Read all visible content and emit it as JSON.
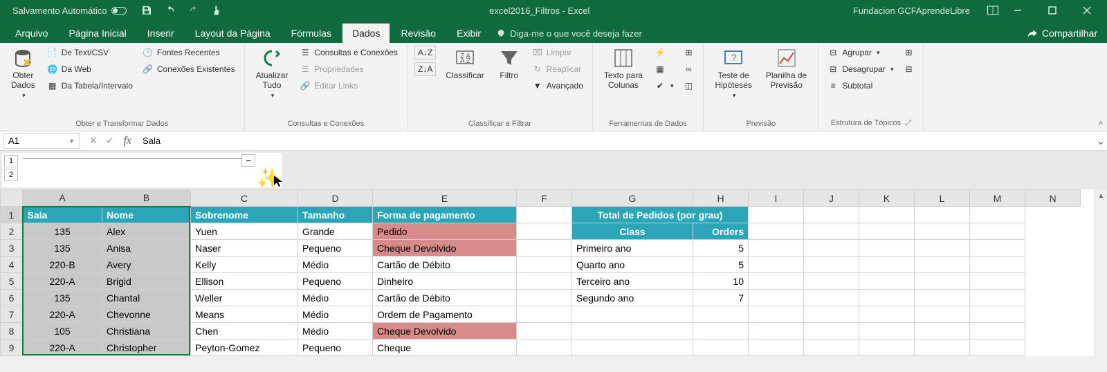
{
  "titlebar": {
    "autosave": "Salvamento Automático",
    "doc_title": "excel2016_Filtros - Excel",
    "account": "Fundacion GCFAprendeLibre"
  },
  "tabs": {
    "arquivo": "Arquivo",
    "inicial": "Página Inicial",
    "inserir": "Inserir",
    "layout": "Layout da Página",
    "formulas": "Fórmulas",
    "dados": "Dados",
    "revisao": "Revisão",
    "exibir": "Exibir",
    "tellme": "Diga-me o que você deseja fazer",
    "share": "Compartilhar"
  },
  "ribbon": {
    "obter_dados": "Obter\nDados",
    "de_text": "De Text/CSV",
    "da_web": "Da Web",
    "da_tabela": "Da Tabela/Intervalo",
    "fontes_recentes": "Fontes Recentes",
    "conexoes_existentes": "Conexões Existentes",
    "grp_obter": "Obter e Transformar Dados",
    "atualizar": "Atualizar\nTudo",
    "consultas": "Consultas e Conexões",
    "propriedades": "Propriedades",
    "editar_links": "Editar Links",
    "grp_consultas": "Consultas e Conexões",
    "az": "A↓Z",
    "za": "Z↓A",
    "classificar": "Classificar",
    "filtro": "Filtro",
    "limpar": "Limpar",
    "reaplicar": "Reaplicar",
    "avancado": "Avançado",
    "grp_classificar": "Classificar e Filtrar",
    "texto_colunas": "Texto para\nColunas",
    "grp_ferramentas": "Ferramentas de Dados",
    "teste": "Teste de\nHipóteses",
    "planilha": "Planilha de\nPrevisão",
    "grp_previsao": "Previsão",
    "agrupar": "Agrupar",
    "desagrupar": "Desagrupar",
    "subtotal": "Subtotal",
    "grp_estrutura": "Estrutura de Tópicos"
  },
  "fbar": {
    "cell_ref": "A1",
    "formula": "Sala"
  },
  "outline": {
    "l1": "1",
    "l2": "2",
    "minus": "−"
  },
  "cols": [
    "A",
    "B",
    "C",
    "D",
    "E",
    "F",
    "G",
    "H",
    "I",
    "J",
    "K",
    "L",
    "M",
    "N"
  ],
  "rows": [
    "1",
    "2",
    "3",
    "4",
    "5",
    "6",
    "7",
    "8",
    "9"
  ],
  "headers": {
    "sala": "Sala",
    "nome": "Nome",
    "sobrenome": "Sobrenome",
    "tamanho": "Tamanho",
    "forma": "Forma de pagamento",
    "total": "Total de Pedidos (por grau)",
    "class": "Class",
    "orders": "Orders"
  },
  "data": {
    "r2": {
      "a": "135",
      "b": "Alex",
      "c": "Yuen",
      "d": "Grande",
      "e": "Pedido",
      "g": "",
      "h": ""
    },
    "r3": {
      "a": "135",
      "b": "Anisa",
      "c": "Naser",
      "d": "Pequeno",
      "e": "Cheque Devolvido",
      "g": "Primeiro ano",
      "h": "5"
    },
    "r4": {
      "a": "220-B",
      "b": "Avery",
      "c": "Kelly",
      "d": "Médio",
      "e": "Cartão de Débito",
      "g": "Quarto ano",
      "h": "5"
    },
    "r5": {
      "a": "220-A",
      "b": "Brigid",
      "c": "Ellison",
      "d": "Pequeno",
      "e": "Dinheiro",
      "g": "Terceiro ano",
      "h": "10"
    },
    "r6": {
      "a": "135",
      "b": "Chantal",
      "c": "Weller",
      "d": "Médio",
      "e": "Cartão de Débito",
      "g": "Segundo ano",
      "h": "7"
    },
    "r7": {
      "a": "220-A",
      "b": "Chevonne",
      "c": "Means",
      "d": "Médio",
      "e": "Ordem de Pagamento",
      "g": "",
      "h": ""
    },
    "r8": {
      "a": "105",
      "b": "Christiana",
      "c": "Chen",
      "d": "Médio",
      "e": "Cheque Devolvido",
      "g": "",
      "h": ""
    },
    "r9": {
      "a": "220-A",
      "b": "Christopher",
      "c": "Peyton-Gomez",
      "d": "Pequeno",
      "e": "Cheque",
      "g": "",
      "h": ""
    }
  }
}
